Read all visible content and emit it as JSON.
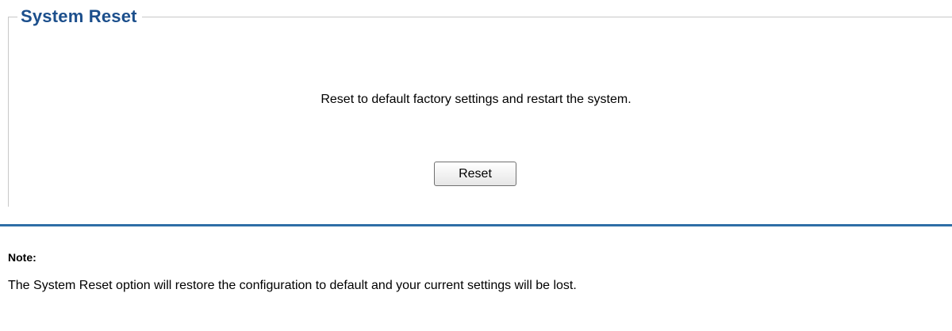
{
  "section": {
    "title": "System Reset",
    "description": "Reset to default factory settings and restart the system.",
    "reset_button_label": "Reset"
  },
  "note": {
    "title": "Note:",
    "text": "The System Reset option will restore the configuration to default and your current settings will be lost."
  },
  "colors": {
    "title": "#1c4f8c",
    "divider": "#2e6ea6",
    "frame_border": "#c8c8c8"
  }
}
